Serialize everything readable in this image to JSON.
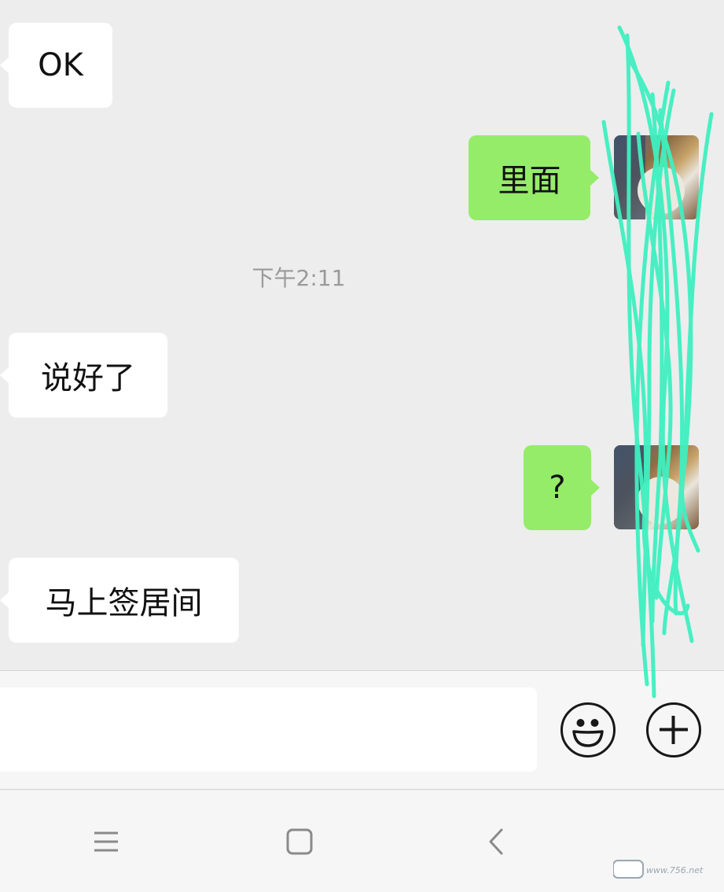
{
  "messages": [
    {
      "side": "incoming",
      "text": "OK"
    },
    {
      "side": "outgoing",
      "text": "里面"
    },
    {
      "side": "incoming",
      "text": "说好了"
    },
    {
      "side": "outgoing",
      "text": "?"
    },
    {
      "side": "incoming",
      "text": "马上签居间"
    }
  ],
  "timestamp": "下午2:11",
  "input": {
    "value": "",
    "placeholder": ""
  },
  "toolbar": {
    "emoji_icon": "smile-emoji-icon",
    "plus_icon": "plus-circle-icon"
  },
  "nav": {
    "menu_icon": "menu-icon",
    "home_icon": "home-square-icon",
    "back_icon": "back-chevron-icon"
  },
  "watermark": "www.756.net",
  "colors": {
    "background": "#ededed",
    "incoming_bubble": "#ffffff",
    "outgoing_bubble": "#95ec69",
    "redaction": "#3ff0c0"
  }
}
